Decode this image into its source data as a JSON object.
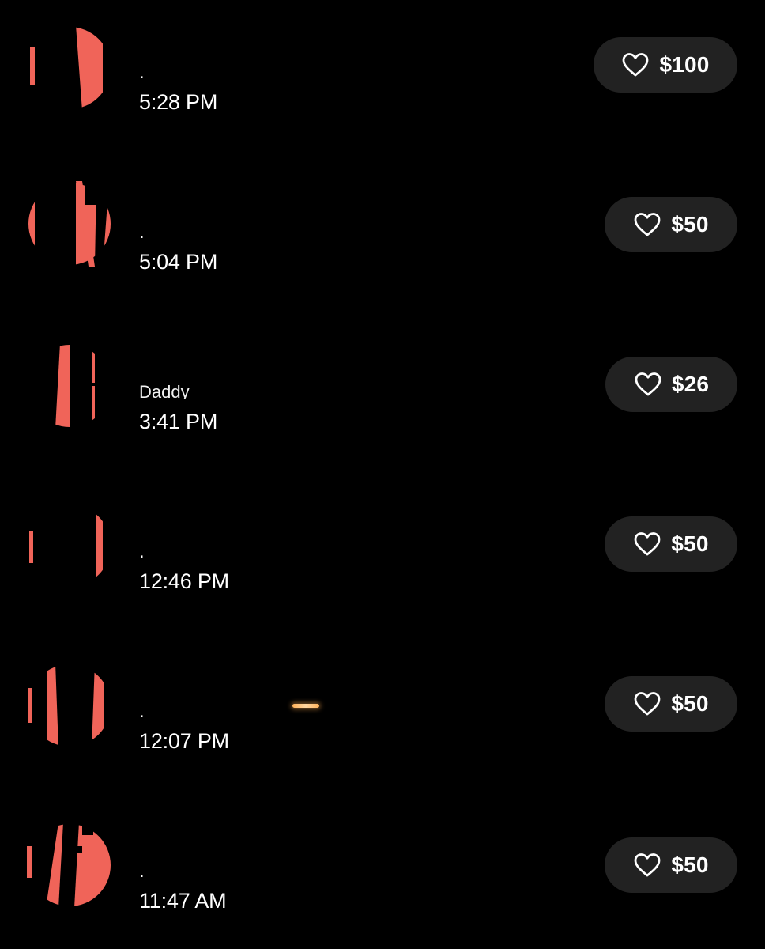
{
  "accent_colors": {
    "avatar": "#f06459",
    "button_bg": "#222222",
    "background": "#000000",
    "text": "#ffffff"
  },
  "tips": [
    {
      "name": "",
      "dot": ".",
      "time": "5:28 PM",
      "amount": "$100",
      "icon": "heart-icon"
    },
    {
      "name": "",
      "dot": ".",
      "time": "5:04 PM",
      "amount": "$50",
      "icon": "heart-icon"
    },
    {
      "name": "Daddy",
      "dot": "",
      "time": "3:41 PM",
      "amount": "$26",
      "icon": "heart-icon"
    },
    {
      "name": "",
      "dot": ".",
      "time": "12:46 PM",
      "amount": "$50",
      "icon": "heart-icon"
    },
    {
      "name": "",
      "dot": ".",
      "time": "12:07 PM",
      "amount": "$50",
      "icon": "heart-icon"
    },
    {
      "name": "",
      "dot": ".",
      "time": "11:47 AM",
      "amount": "$50",
      "icon": "heart-icon"
    }
  ]
}
